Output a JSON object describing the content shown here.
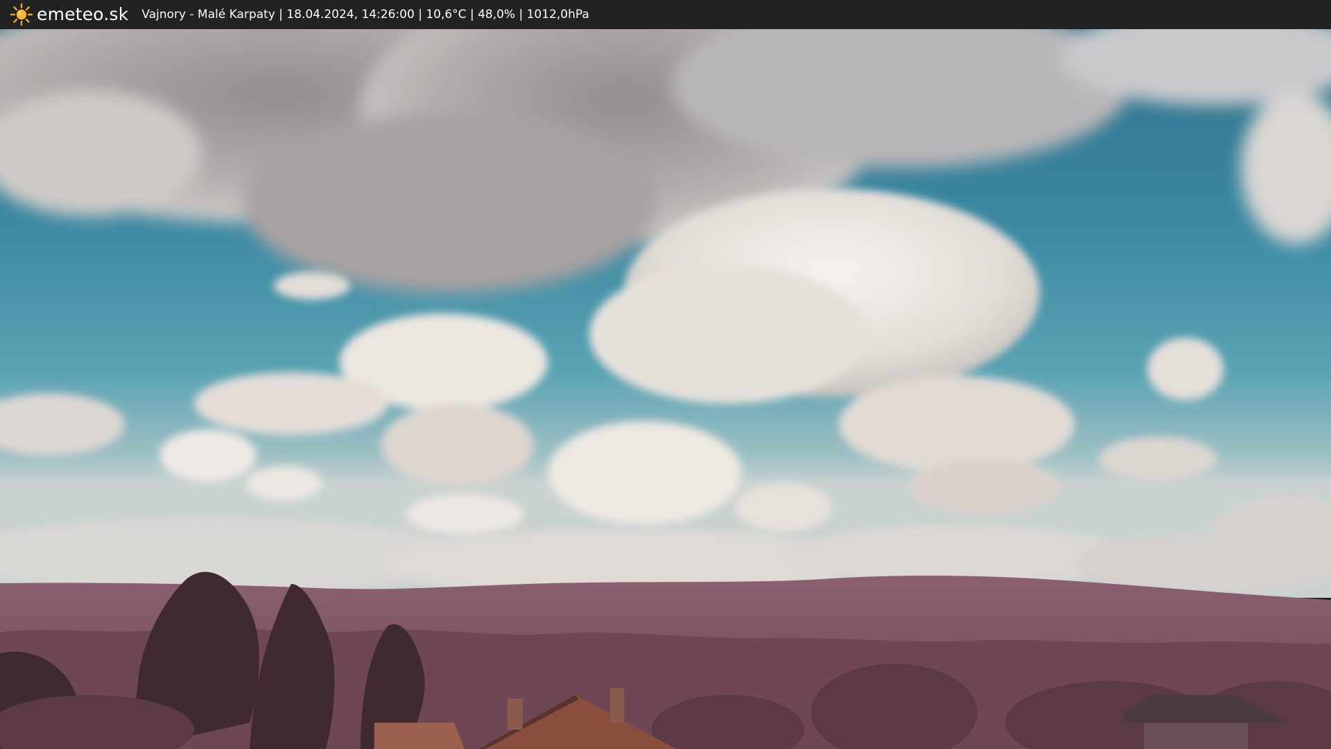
{
  "header": {
    "logo_icon": "sun-icon",
    "brand": "emeteo.sk",
    "caption": "Vajnory - Malé Karpaty | 18.04.2024, 14:26:00 | 10,6°C | 48,0% | 1012,0hPa"
  },
  "scene": {
    "sky_color": "#3f8ea6",
    "cloud_color": "#e8e2dc",
    "hill_color": "#7a5462",
    "foreground_color": "#5a3a44"
  }
}
